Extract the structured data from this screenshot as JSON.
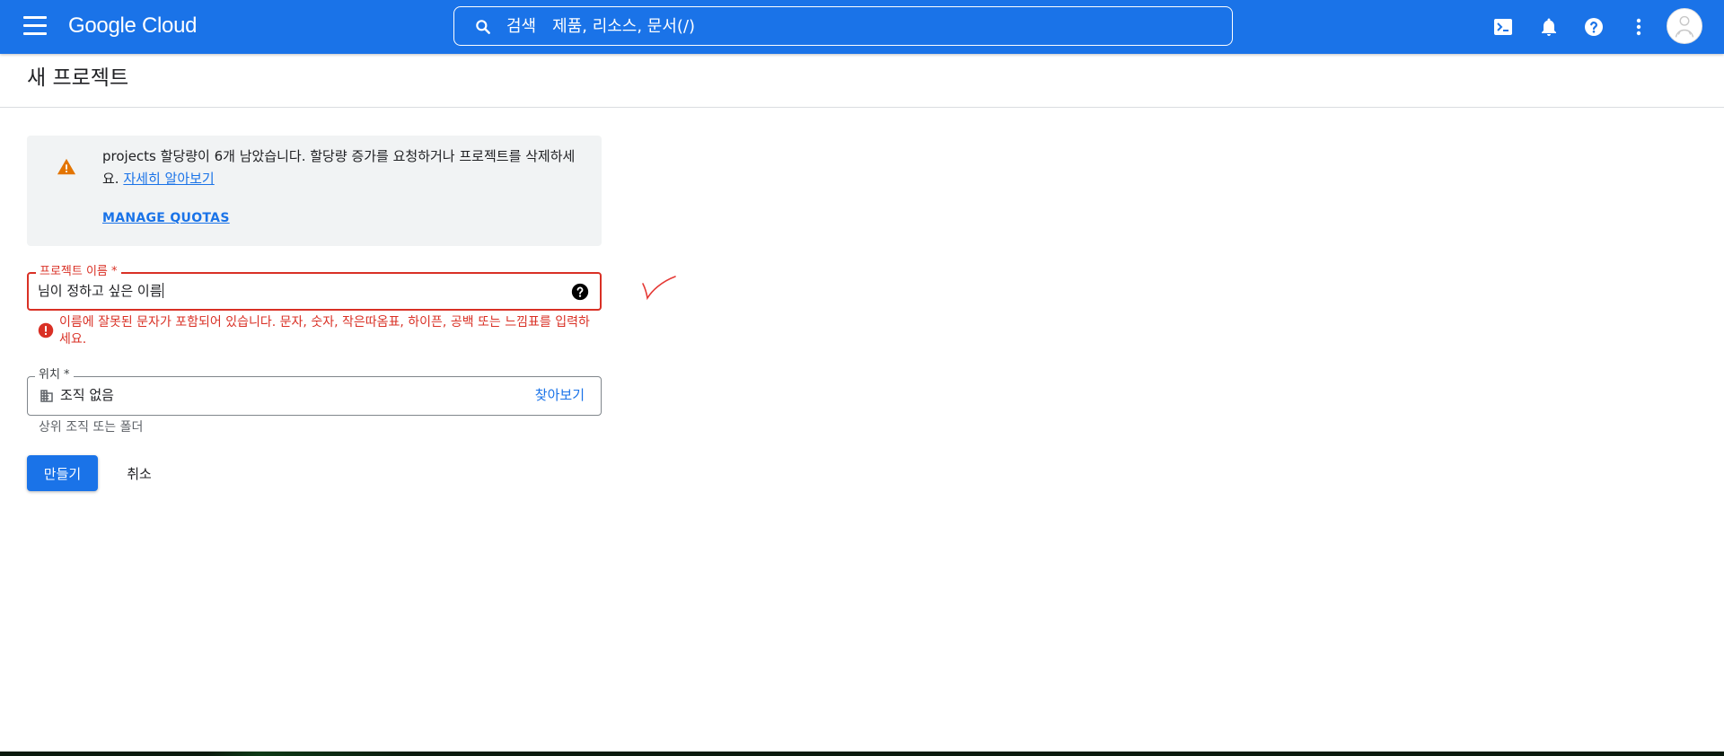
{
  "topbar": {
    "brand": "Google Cloud",
    "search": {
      "label": "검색",
      "placeholder": "제품, 리소스, 문서(/)"
    },
    "icons": [
      "menu-icon",
      "search-icon",
      "cloud-shell-icon",
      "notifications-icon",
      "help-icon",
      "more-vert-icon",
      "avatar"
    ]
  },
  "page": {
    "title": "새 프로젝트"
  },
  "quota_notice": {
    "text": "projects 할당량이 6개 남았습니다. 할당량 증가를 요청하거나 프로젝트를 삭제하세요.",
    "learn_more": "자세히 알아보기",
    "manage_quotas": "MANAGE QUOTAS"
  },
  "form": {
    "project_name": {
      "label": "프로젝트 이름 *",
      "value": "님이 정하고 싶은 이름",
      "error": "이름에 잘못된 문자가 포함되어 있습니다. 문자, 숫자, 작은따옴표, 하이픈, 공백 또는 느낌표를 입력하세요."
    },
    "location": {
      "label": "위치 *",
      "value": "조직 없음",
      "browse": "찾아보기",
      "hint": "상위 조직 또는 폴더"
    },
    "create_button": "만들기",
    "cancel_button": "취소"
  },
  "colors": {
    "brand_blue": "#1a73e8",
    "error_red": "#d93025",
    "warning_orange": "#e37400",
    "notice_bg": "#f1f3f4"
  }
}
